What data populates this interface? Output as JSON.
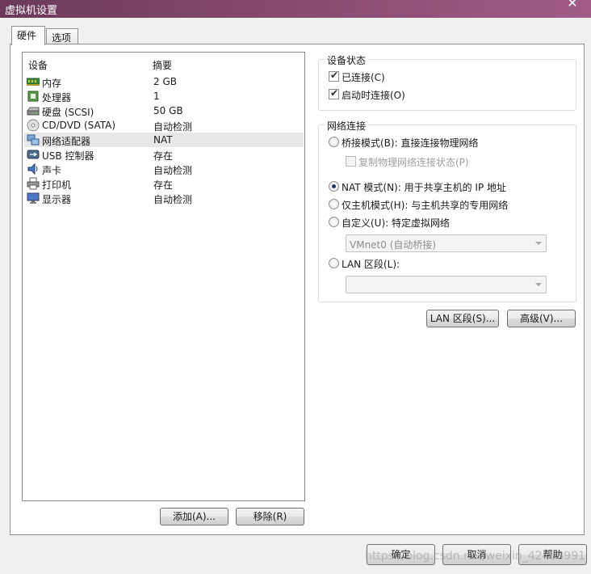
{
  "window": {
    "title": "虚拟机设置",
    "close_label": "✕"
  },
  "tabs": [
    {
      "label": "硬件",
      "active": true
    },
    {
      "label": "选项",
      "active": false
    }
  ],
  "device_list": {
    "header": {
      "device": "设备",
      "summary": "摘要"
    },
    "rows": [
      {
        "icon": "memory-icon",
        "name": "内存",
        "summary": "2 GB"
      },
      {
        "icon": "processor-icon",
        "name": "处理器",
        "summary": "1"
      },
      {
        "icon": "hard-disk-icon",
        "name": "硬盘 (SCSI)",
        "summary": "50 GB"
      },
      {
        "icon": "cd-dvd-icon",
        "name": "CD/DVD (SATA)",
        "summary": "自动检测"
      },
      {
        "icon": "network-adapter-icon",
        "name": "网络适配器",
        "summary": "NAT",
        "selected": true
      },
      {
        "icon": "usb-icon",
        "name": "USB 控制器",
        "summary": "存在"
      },
      {
        "icon": "sound-card-icon",
        "name": "声卡",
        "summary": "自动检测"
      },
      {
        "icon": "printer-icon",
        "name": "打印机",
        "summary": "存在"
      },
      {
        "icon": "display-icon",
        "name": "显示器",
        "summary": "自动检测"
      }
    ]
  },
  "list_buttons": {
    "add": "添加(A)...",
    "remove": "移除(R)"
  },
  "device_status": {
    "title": "设备状态",
    "connected": {
      "label": "已连接(C)",
      "checked": true
    },
    "connect_at_power_on": {
      "label": "启动时连接(O)",
      "checked": true
    }
  },
  "network": {
    "title": "网络连接",
    "bridged": {
      "label": "桥接模式(B): 直接连接物理网络",
      "selected": false
    },
    "replicate": {
      "label": "复制物理网络连接状态(P)",
      "checked": false
    },
    "nat": {
      "label": "NAT 模式(N): 用于共享主机的 IP 地址",
      "selected": true
    },
    "host_only": {
      "label": "仅主机模式(H): 与主机共享的专用网络",
      "selected": false
    },
    "custom": {
      "label": "自定义(U): 特定虚拟网络",
      "selected": false
    },
    "custom_combo": {
      "value": "VMnet0 (自动桥接)"
    },
    "lan_segment": {
      "label": "LAN 区段(L):",
      "selected": false
    },
    "lan_combo": {
      "value": ""
    }
  },
  "network_buttons": {
    "lan_segments": "LAN 区段(S)...",
    "advanced": "高级(V)..."
  },
  "footer": {
    "ok": "确定",
    "cancel": "取消",
    "help": "帮助"
  },
  "watermark": "https://blog.csdn.net/weixin_42488991"
}
